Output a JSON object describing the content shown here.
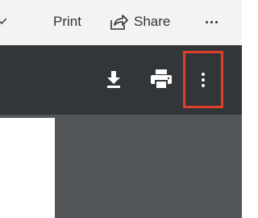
{
  "app_toolbar": {
    "print_label": "Print",
    "share_label": "Share"
  },
  "viewer_toolbar": {
    "icons": [
      "download-icon",
      "print-icon",
      "more-options-icon"
    ],
    "highlight_color": "#e23f2a"
  },
  "colors": {
    "toolbar_bg": "#f3f3f3",
    "viewer_toolbar_bg": "#323639",
    "doc_area_bg": "#535659",
    "page_bg": "#ffffff"
  }
}
